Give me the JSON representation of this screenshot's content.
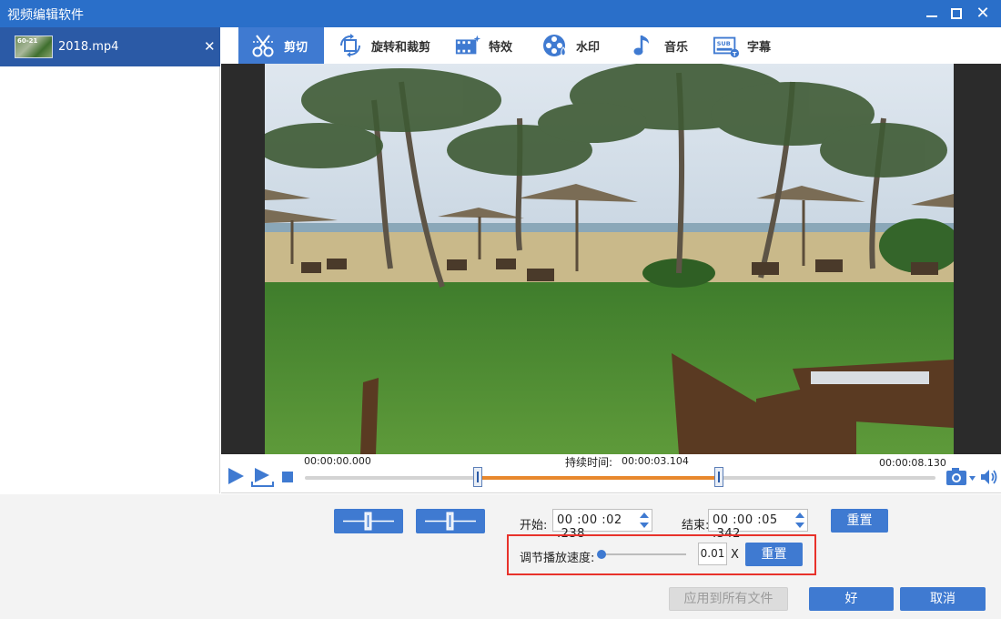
{
  "window": {
    "title": "视频编辑软件"
  },
  "file_list": [
    {
      "name": "2018.mp4",
      "thumb_text": "60-21"
    }
  ],
  "tabs": [
    {
      "label": "剪切",
      "icon": "scissors-icon",
      "active": true
    },
    {
      "label": "旋转和裁剪",
      "icon": "rotate-crop-icon",
      "active": false
    },
    {
      "label": "特效",
      "icon": "film-effects-icon",
      "active": false
    },
    {
      "label": "水印",
      "icon": "watermark-icon",
      "active": false
    },
    {
      "label": "音乐",
      "icon": "music-note-icon",
      "active": false
    },
    {
      "label": "字幕",
      "icon": "subtitle-icon",
      "active": false
    }
  ],
  "timeline": {
    "start_time": "00:00:00.000",
    "end_time": "00:00:08.130",
    "duration_label": "持续时间:",
    "duration_value": "00:00:03.104"
  },
  "trim": {
    "start_label": "开始:",
    "start_value": "00 :00 :02 .238",
    "end_label": "结束:",
    "end_value": "00 :00 :05 .342",
    "reset_label": "重置"
  },
  "speed": {
    "label": "调节播放速度:",
    "value": "0.01",
    "unit": "X",
    "reset_label": "重置"
  },
  "footer": {
    "apply_all_label": "应用到所有文件",
    "ok_label": "好",
    "cancel_label": "取消"
  },
  "colors": {
    "titlebar": "#2a6fc9",
    "accent": "#3f7ad1",
    "selected_range": "#e8882d",
    "highlight_box": "#e8322b"
  }
}
